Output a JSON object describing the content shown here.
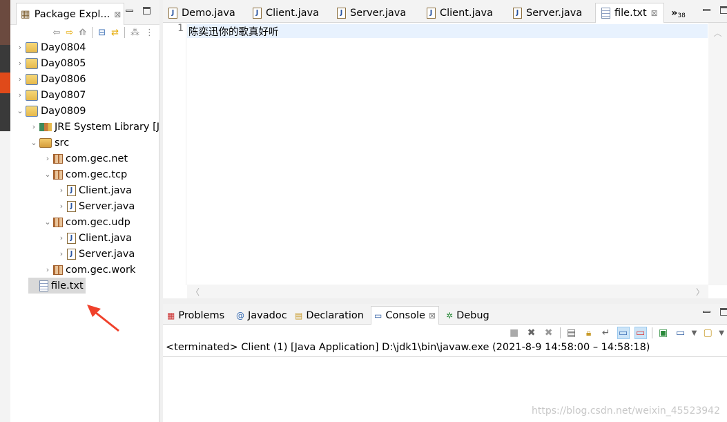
{
  "explorer": {
    "title": "Package Expl...",
    "tree": [
      {
        "label": "Day0804",
        "level": 0,
        "twisty": "collapsed",
        "icon": "project-folder-icon"
      },
      {
        "label": "Day0805",
        "level": 0,
        "twisty": "collapsed",
        "icon": "project-folder-icon"
      },
      {
        "label": "Day0806",
        "level": 0,
        "twisty": "collapsed",
        "icon": "project-folder-icon"
      },
      {
        "label": "Day0807",
        "level": 0,
        "twisty": "collapsed",
        "icon": "project-folder-icon"
      },
      {
        "label": "Day0809",
        "level": 0,
        "twisty": "expanded",
        "icon": "project-folder-icon"
      },
      {
        "label": "JRE System Library [J",
        "level": 1,
        "twisty": "collapsed",
        "icon": "library-icon"
      },
      {
        "label": "src",
        "level": 1,
        "twisty": "expanded",
        "icon": "source-folder-icon"
      },
      {
        "label": "com.gec.net",
        "level": 2,
        "twisty": "collapsed",
        "icon": "package-icon"
      },
      {
        "label": "com.gec.tcp",
        "level": 2,
        "twisty": "expanded",
        "icon": "package-icon"
      },
      {
        "label": "Client.java",
        "level": 3,
        "twisty": "collapsed",
        "icon": "java-file-icon"
      },
      {
        "label": "Server.java",
        "level": 3,
        "twisty": "collapsed",
        "icon": "java-file-icon"
      },
      {
        "label": "com.gec.udp",
        "level": 2,
        "twisty": "expanded",
        "icon": "package-icon"
      },
      {
        "label": "Client.java",
        "level": 3,
        "twisty": "collapsed",
        "icon": "java-file-icon"
      },
      {
        "label": "Server.java",
        "level": 3,
        "twisty": "collapsed",
        "icon": "java-file-icon"
      },
      {
        "label": "com.gec.work",
        "level": 2,
        "twisty": "collapsed",
        "icon": "package-icon"
      },
      {
        "label": "file.txt",
        "level": 1,
        "twisty": "none",
        "icon": "text-file-icon",
        "selected": true
      }
    ]
  },
  "editor": {
    "tabs": [
      {
        "label": "Demo.java",
        "icon": "java-file-icon"
      },
      {
        "label": "Client.java",
        "icon": "java-file-icon"
      },
      {
        "label": "Server.java",
        "icon": "java-file-icon"
      },
      {
        "label": "Client.java",
        "icon": "java-file-icon"
      },
      {
        "label": "Server.java",
        "icon": "java-file-icon"
      },
      {
        "label": "file.txt",
        "icon": "text-file-icon",
        "active": true
      }
    ],
    "overflow_count": "38",
    "line_number": "1",
    "content": "陈奕迅你的歌真好听"
  },
  "bottom": {
    "tabs": [
      {
        "label": "Problems",
        "icon": "problems-icon"
      },
      {
        "label": "Javadoc",
        "icon": "at-icon"
      },
      {
        "label": "Declaration",
        "icon": "declaration-icon"
      },
      {
        "label": "Console",
        "icon": "console-icon",
        "active": true
      },
      {
        "label": "Debug",
        "icon": "debug-icon"
      }
    ],
    "console_status": "<terminated> Client (1) [Java Application] D:\\jdk1\\bin\\javaw.exe  (2021-8-9 14:58:00 – 14:58:18)"
  },
  "watermark": "https://blog.csdn.net/weixin_45523942",
  "colors": {
    "annotation_arrow": "#f0412b",
    "selection": "#d9d9d9",
    "current_line": "#e8f2fe"
  }
}
